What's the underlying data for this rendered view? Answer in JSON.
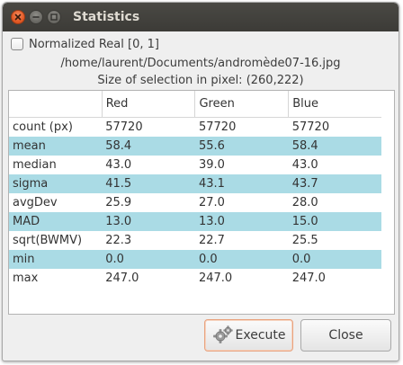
{
  "window": {
    "title": "Statistics"
  },
  "options": {
    "normalized_label": "Normalized Real [0, 1]",
    "normalized_checked": false
  },
  "info": {
    "file_path": "/home/laurent/Documents/andromède07-16.jpg",
    "selection_size": "Size of selection in pixel: (260,222)"
  },
  "table": {
    "headers": [
      "",
      "Red",
      "Green",
      "Blue"
    ],
    "rows": [
      {
        "label": "count (px)",
        "red": "57720",
        "green": "57720",
        "blue": "57720"
      },
      {
        "label": "mean",
        "red": "58.4",
        "green": "55.6",
        "blue": "58.4"
      },
      {
        "label": "median",
        "red": "43.0",
        "green": "39.0",
        "blue": "43.0"
      },
      {
        "label": "sigma",
        "red": "41.5",
        "green": "43.1",
        "blue": "43.7"
      },
      {
        "label": "avgDev",
        "red": "25.9",
        "green": "27.0",
        "blue": "28.0"
      },
      {
        "label": "MAD",
        "red": "13.0",
        "green": "13.0",
        "blue": "15.0"
      },
      {
        "label": "sqrt(BWMV)",
        "red": "22.3",
        "green": "22.7",
        "blue": "25.5"
      },
      {
        "label": "min",
        "red": "0.0",
        "green": "0.0",
        "blue": "0.0"
      },
      {
        "label": "max",
        "red": "247.0",
        "green": "247.0",
        "blue": "247.0"
      }
    ]
  },
  "buttons": {
    "execute_label": "Execute",
    "execute_icon": "gears-icon",
    "close_label": "Close"
  },
  "colors": {
    "titlebar": "#3c3b37",
    "close_button": "#e35a26",
    "row_highlight": "#aadbe5"
  }
}
